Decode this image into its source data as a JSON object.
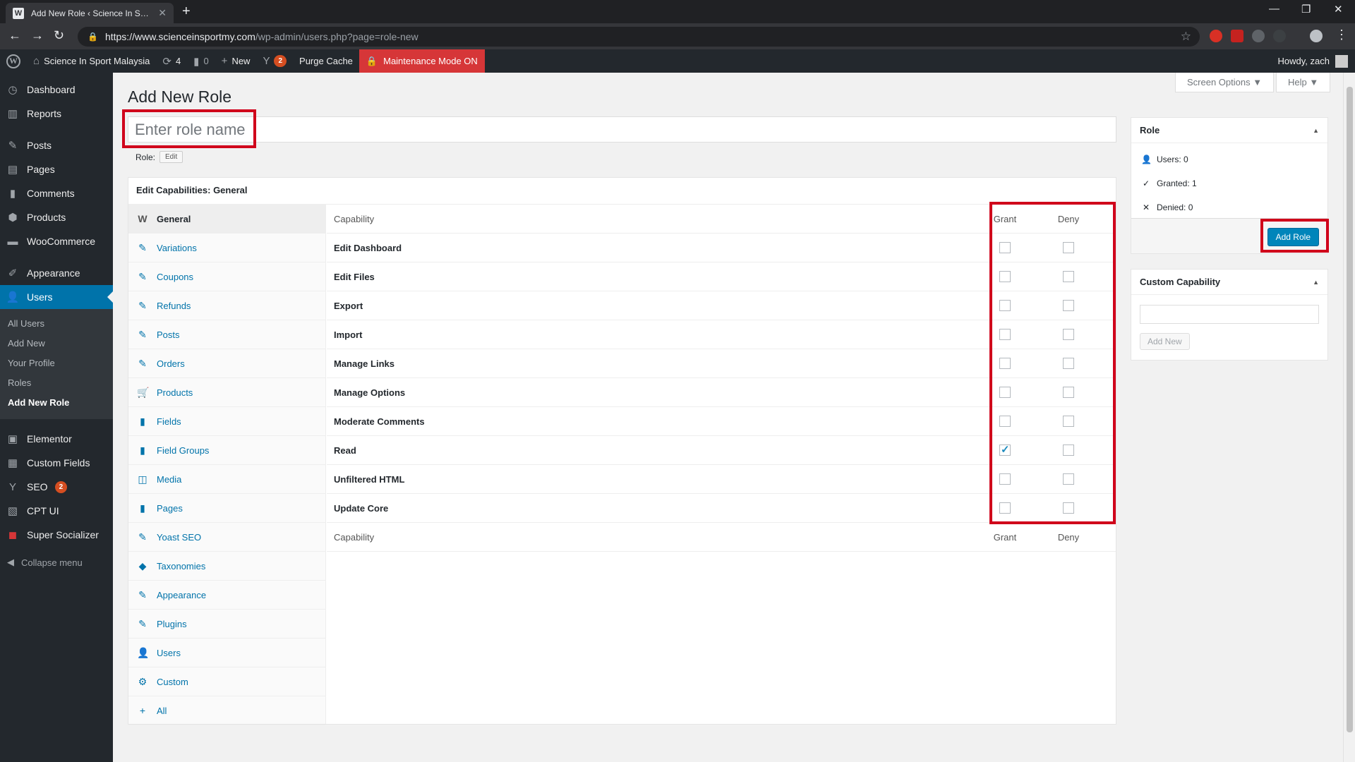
{
  "browser": {
    "tab_title": "Add New Role ‹ Science In Sport",
    "url_host": "https://www.scienceinsportmy.com",
    "url_path": "/wp-admin/users.php?page=role-new"
  },
  "adminbar": {
    "site_name": "Science In Sport Malaysia",
    "updates_count": "4",
    "comments_count": "0",
    "new_label": "New",
    "yoast_badge": "2",
    "purge_cache": "Purge Cache",
    "maintenance": "Maintenance Mode ON",
    "howdy": "Howdy, zach"
  },
  "sidebar": {
    "items": [
      {
        "label": "Dashboard",
        "icon": "dashboard-icon"
      },
      {
        "label": "Reports",
        "icon": "reports-icon"
      },
      {
        "label": "Posts",
        "icon": "pin-icon"
      },
      {
        "label": "Pages",
        "icon": "pages-icon"
      },
      {
        "label": "Comments",
        "icon": "comments-icon"
      },
      {
        "label": "Products",
        "icon": "products-icon"
      },
      {
        "label": "WooCommerce",
        "icon": "woocommerce-icon"
      },
      {
        "label": "Appearance",
        "icon": "brush-icon"
      },
      {
        "label": "Users",
        "icon": "users-icon"
      }
    ],
    "users_sub": [
      "All Users",
      "Add New",
      "Your Profile",
      "Roles",
      "Add New Role"
    ],
    "more": [
      {
        "label": "Elementor",
        "icon": "elementor-icon"
      },
      {
        "label": "Custom Fields",
        "icon": "custom-fields-icon"
      },
      {
        "label": "SEO",
        "icon": "seo-icon",
        "badge": "2"
      },
      {
        "label": "CPT UI",
        "icon": "cpt-icon"
      },
      {
        "label": "Super Socializer",
        "icon": "socializer-icon"
      }
    ],
    "collapse": "Collapse menu"
  },
  "header": {
    "screen_options": "Screen Options ▼",
    "help": "Help ▼",
    "title": "Add New Role",
    "role_placeholder": "Enter role name",
    "role_label": "Role:",
    "edit_label": "Edit"
  },
  "capabilities": {
    "heading": "Edit Capabilities: General",
    "tabs": [
      "General",
      "Variations",
      "Coupons",
      "Refunds",
      "Posts",
      "Orders",
      "Products",
      "Fields",
      "Field Groups",
      "Media",
      "Pages",
      "Yoast SEO",
      "Taxonomies",
      "Appearance",
      "Plugins",
      "Users",
      "Custom",
      "All"
    ],
    "col_capability": "Capability",
    "col_grant": "Grant",
    "col_deny": "Deny",
    "rows": [
      {
        "name": "Edit Dashboard",
        "grant": false,
        "deny": false
      },
      {
        "name": "Edit Files",
        "grant": false,
        "deny": false
      },
      {
        "name": "Export",
        "grant": false,
        "deny": false
      },
      {
        "name": "Import",
        "grant": false,
        "deny": false
      },
      {
        "name": "Manage Links",
        "grant": false,
        "deny": false
      },
      {
        "name": "Manage Options",
        "grant": false,
        "deny": false
      },
      {
        "name": "Moderate Comments",
        "grant": false,
        "deny": false
      },
      {
        "name": "Read",
        "grant": true,
        "deny": false
      },
      {
        "name": "Unfiltered HTML",
        "grant": false,
        "deny": false
      },
      {
        "name": "Update Core",
        "grant": false,
        "deny": false
      }
    ]
  },
  "rolebox": {
    "title": "Role",
    "users": "Users: 0",
    "granted": "Granted: 1",
    "denied": "Denied: 0",
    "add_role": "Add Role"
  },
  "custombox": {
    "title": "Custom Capability",
    "add_new": "Add New"
  },
  "colors": {
    "accent": "#0073aa",
    "highlight": "#d0021b",
    "maintenance": "#d63638"
  }
}
